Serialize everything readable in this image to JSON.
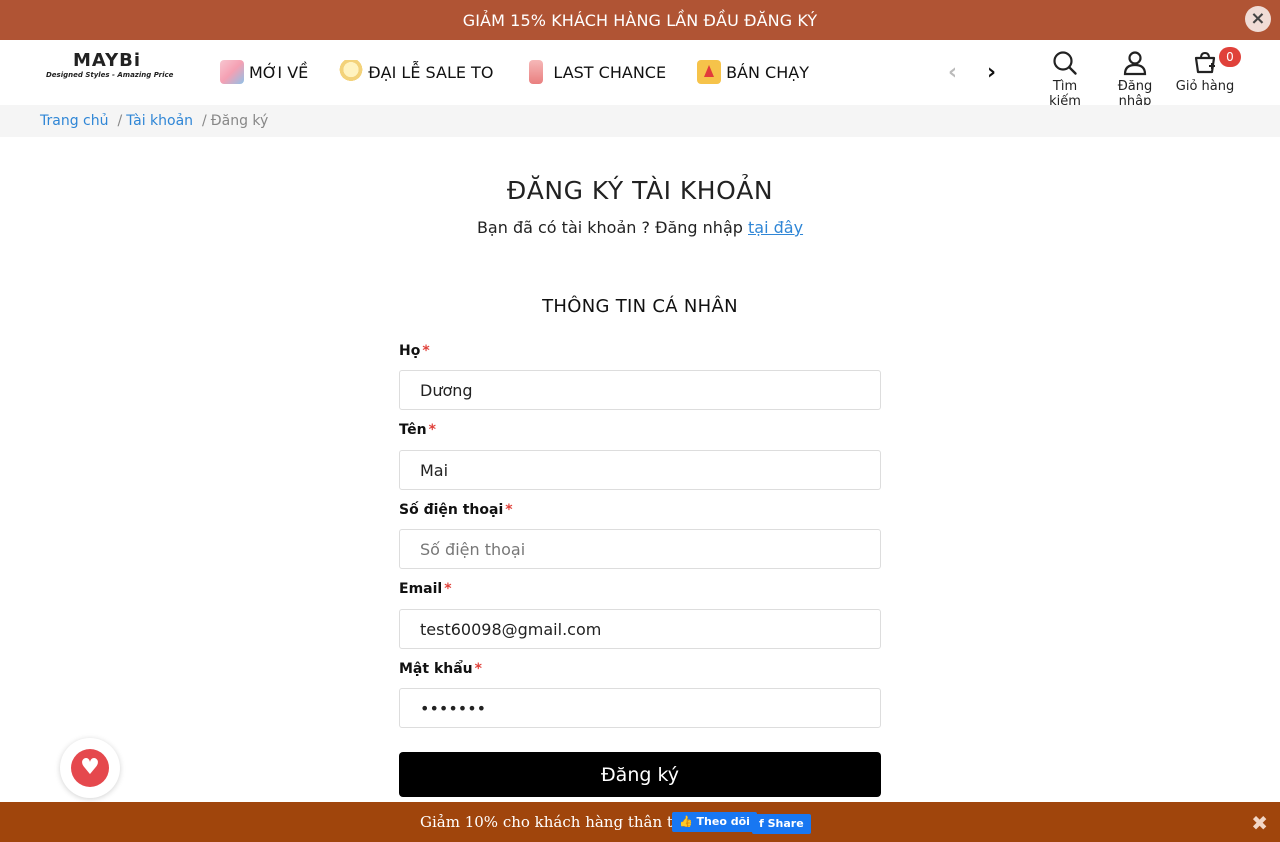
{
  "announcement": {
    "text": "GIẢM 15% KHÁCH HÀNG LẦN ĐẦU ĐĂNG KÝ",
    "close": "×"
  },
  "logo": {
    "brand": "MAYBi",
    "tagline": "Designed Styles - Amazing Price"
  },
  "nav": [
    {
      "label": "MỚI VỀ",
      "icon": "shopping-bag-icon"
    },
    {
      "label": "ĐẠI LỄ SALE TO",
      "icon": "gift-icon"
    },
    {
      "label": "LAST CHANCE",
      "icon": "dress-icon"
    },
    {
      "label": "BÁN CHẠY",
      "icon": "hot-icon"
    }
  ],
  "nav_arrows": {
    "prev": "‹",
    "next": "›"
  },
  "header_actions": {
    "search": "Tìm kiếm",
    "login": "Đăng nhập",
    "cart": "Giỏ hàng",
    "cart_count": "0"
  },
  "breadcrumb": {
    "home": "Trang chủ",
    "sep": "/",
    "account": "Tài khoản",
    "current": "Đăng ký"
  },
  "page": {
    "title": "ĐĂNG KÝ TÀI KHOẢN",
    "subtitle": "Bạn đã có tài khoản ? Đăng nhập",
    "subtitle_link": "tại đây",
    "section_title": "THÔNG TIN CÁ NHÂN"
  },
  "form": {
    "last_name": {
      "label": "Họ",
      "value": "Dương"
    },
    "first_name": {
      "label": "Tên",
      "value": "Mai"
    },
    "phone": {
      "label": "Số điện thoại",
      "placeholder": "Số điện thoại",
      "value": ""
    },
    "email": {
      "label": "Email",
      "value": "test60098@gmail.com"
    },
    "password": {
      "label": "Mật khẩu",
      "value": "1234567"
    },
    "required_mark": "*",
    "submit": "Đăng ký"
  },
  "favorite": {
    "icon": "heart-icon",
    "glyph": "♥"
  },
  "bottom_bar": {
    "promo": "Giảm 10% cho khách hàng thân thiết",
    "follow": "👍 Theo dõi",
    "share": "f Share",
    "close": "✖"
  },
  "colors": {
    "announcement_bg": "#b05434",
    "bottom_bg": "#a0450c",
    "link": "#2f86d6",
    "required": "#e0413a",
    "submit_bg": "#000000"
  }
}
